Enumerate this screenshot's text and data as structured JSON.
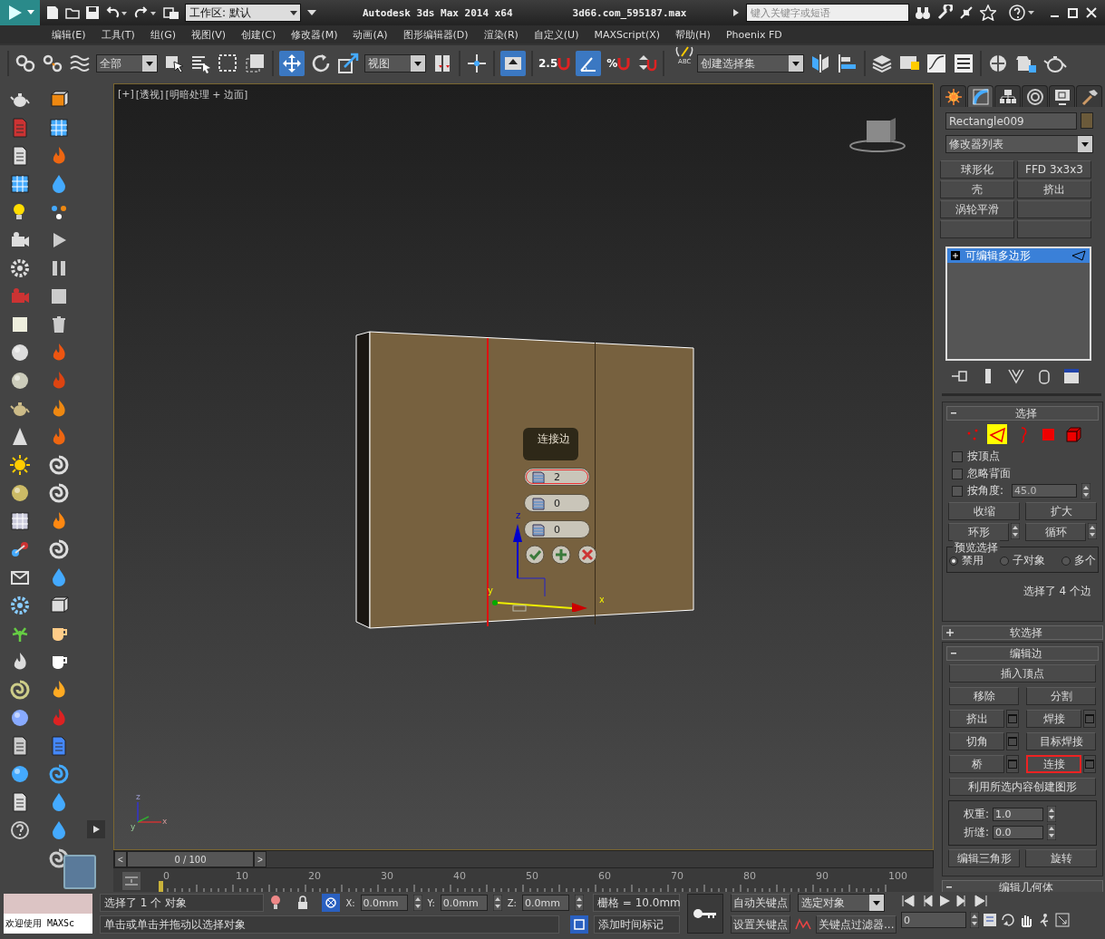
{
  "title_bar": {
    "workspace": "工作区: 默认",
    "title": "Autodesk 3ds Max  2014 x64",
    "file_name": "3d66.com_595187.max",
    "search": {
      "placeholder": "键入关键字或短语"
    }
  },
  "menu_bar": [
    "编辑(E)",
    "工具(T)",
    "组(G)",
    "视图(V)",
    "创建(C)",
    "修改器(M)",
    "动画(A)",
    "图形编辑器(D)",
    "渲染(R)",
    "自定义(U)",
    "MAXScript(X)",
    "帮助(H)",
    "Phoenix FD"
  ],
  "main_toolbar": {
    "selection_filter": "全部",
    "reference_coord": "视图",
    "snap_label": "2.5",
    "percent_snap_label": "%",
    "named_selection_label": "ABC",
    "named_selection_set": "创建选择集"
  },
  "viewport": {
    "labels": [
      "[+]",
      "[透视]",
      "[明暗处理 + 边面]"
    ],
    "caddy": {
      "title": "连接边",
      "fields": [
        {
          "value": "2",
          "selected": true
        },
        {
          "value": "0",
          "selected": false
        },
        {
          "value": "0",
          "selected": false
        }
      ]
    },
    "gizmo_labels": {
      "x": "x",
      "y": "y",
      "z": "z"
    },
    "corner_axis_labels": {
      "x": "x",
      "y": "y",
      "z": "z"
    }
  },
  "command_panel": {
    "tabs": [
      {
        "selected": false
      },
      {
        "selected": true
      },
      {
        "selected": false
      },
      {
        "selected": false
      },
      {
        "selected": false
      },
      {
        "selected": false
      }
    ],
    "object_name": "Rectangle009",
    "modifier_list": "修改器列表",
    "modifier_buttons": [
      "球形化",
      "FFD 3x3x3",
      "壳",
      "挤出",
      "涡轮平滑"
    ],
    "stack": [
      {
        "label": "可编辑多边形",
        "selected": true
      }
    ],
    "selection": {
      "title": "选择",
      "expanded": true,
      "subobjects": [
        {
          "selected": false
        },
        {
          "selected": true
        },
        {
          "selected": false
        },
        {
          "selected": false
        },
        {
          "selected": false
        }
      ],
      "checks": [
        {
          "label": "按顶点",
          "checked": false
        },
        {
          "label": "忽略背面",
          "checked": false
        },
        {
          "label": "按角度:",
          "checked": false,
          "value": "45.0"
        }
      ],
      "buttons": [
        {
          "label": "收缩",
          "spinner": false
        },
        {
          "label": "扩大",
          "spinner": false
        },
        {
          "label": "环形",
          "spinner": true
        },
        {
          "label": "循环",
          "spinner": true
        }
      ],
      "preview": {
        "title": "预览选择",
        "options": [
          {
            "label": "禁用",
            "selected": true
          },
          {
            "label": "子对象",
            "selected": false
          },
          {
            "label": "多个",
            "selected": false
          }
        ]
      },
      "status": "选择了 4 个边"
    },
    "soft_selection": {
      "title": "软选择",
      "expanded": false
    },
    "edit_edges": {
      "title": "编辑边",
      "expanded": true,
      "rows": [
        {
          "buttons": [
            {
              "label": "插入顶点",
              "settings": false,
              "highlighted": false
            }
          ]
        },
        {
          "buttons": [
            {
              "label": "移除",
              "settings": false,
              "highlighted": false
            },
            {
              "label": "分割",
              "settings": false,
              "highlighted": false
            }
          ]
        },
        {
          "buttons": [
            {
              "label": "挤出",
              "settings": true,
              "highlighted": false
            },
            {
              "label": "焊接",
              "settings": true,
              "highlighted": false
            }
          ]
        },
        {
          "buttons": [
            {
              "label": "切角",
              "settings": true,
              "highlighted": false
            },
            {
              "label": "目标焊接",
              "settings": false,
              "highlighted": false
            }
          ]
        },
        {
          "buttons": [
            {
              "label": "桥",
              "settings": true,
              "highlighted": false
            },
            {
              "label": "连接",
              "settings": true,
              "highlighted": true
            }
          ]
        },
        {
          "buttons": [
            {
              "label": "利用所选内容创建图形",
              "settings": false,
              "highlighted": false
            }
          ]
        }
      ],
      "weight": {
        "label": "权重:",
        "value": "1.0"
      },
      "crease": {
        "label": "折缝:",
        "value": "0.0"
      },
      "bottom_buttons": [
        "编辑三角形",
        "旋转"
      ]
    },
    "edit_geometry": {
      "title": "编辑几何体",
      "expanded": true
    }
  },
  "timeline": {
    "slider": "0 / 100",
    "level": 0,
    "prev": "<",
    "next": ">",
    "ruler_labels": [
      "0",
      "10",
      "20",
      "30",
      "40",
      "50",
      "60",
      "70",
      "80",
      "90",
      "100"
    ]
  },
  "status_bar": {
    "listener": "欢迎使用 MAXSc",
    "selection_info": "选择了 1 个 对象",
    "prompt": "单击或单击并拖动以选择对象",
    "coords": [
      {
        "axis": "X:",
        "value": "0.0mm"
      },
      {
        "axis": "Y:",
        "value": "0.0mm"
      },
      {
        "axis": "Z:",
        "value": "0.0mm"
      }
    ],
    "grid": "栅格 = 10.0mm",
    "add_time_tag": "添加时间标记",
    "auto_key": "自动关键点",
    "key_mode": "选定对象",
    "set_key": "设置关键点",
    "key_filters": "关键点过滤器...",
    "frame": "0"
  }
}
